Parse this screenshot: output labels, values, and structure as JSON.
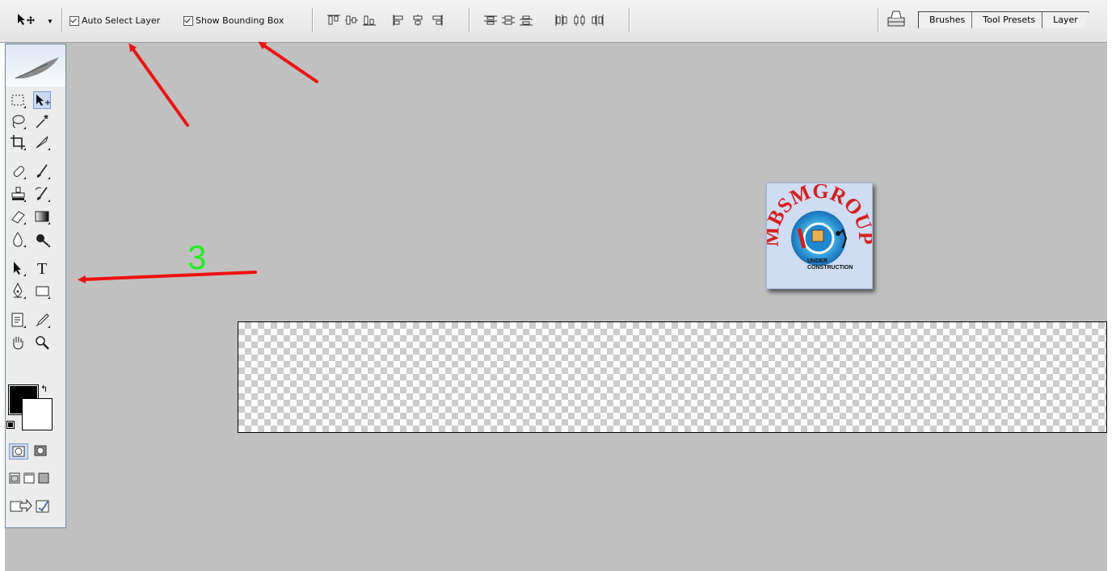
{
  "options_bar": {
    "tool_icon": "move-tool-icon",
    "auto_select_layer": {
      "label": "Auto Select Layer",
      "checked": true
    },
    "show_bounding_box": {
      "label": "Show Bounding Box",
      "checked": true
    },
    "align_buttons": [
      "align-top-icon",
      "align-vcenter-icon",
      "align-bottom-icon",
      "align-left-icon",
      "align-hcenter-icon",
      "align-right-icon"
    ],
    "distribute_buttons": [
      "distribute-top-icon",
      "distribute-vcenter-icon",
      "distribute-bottom-icon",
      "distribute-left-icon",
      "distribute-hcenter-icon",
      "distribute-right-icon"
    ],
    "palette_well_icon": "palette-well-icon"
  },
  "panel_tabs": [
    "Brushes",
    "Tool Presets",
    "Layer"
  ],
  "toolbox": {
    "tools": [
      "marquee-tool-icon",
      "move-tool-icon",
      "lasso-tool-icon",
      "magic-wand-tool-icon",
      "crop-tool-icon",
      "slice-tool-icon",
      "healing-brush-tool-icon",
      "brush-tool-icon",
      "clone-stamp-tool-icon",
      "history-brush-tool-icon",
      "eraser-tool-icon",
      "gradient-tool-icon",
      "blur-tool-icon",
      "dodge-tool-icon",
      "path-selection-tool-icon",
      "type-tool-icon",
      "pen-tool-icon",
      "shape-tool-icon",
      "notes-tool-icon",
      "eyedropper-tool-icon",
      "hand-tool-icon",
      "zoom-tool-icon"
    ],
    "type_tool_glyph": "T",
    "foreground_color": "#000000",
    "background_color": "#ffffff"
  },
  "canvas": {
    "logo": {
      "arc_text": "MBSMGROUP",
      "caption_line1": "UNDER",
      "caption_line2": "CONSTRUCTION"
    }
  },
  "annotations": {
    "arrow_color": "#ee1111",
    "label_3": "3",
    "label_3_color": "#22ee22"
  }
}
